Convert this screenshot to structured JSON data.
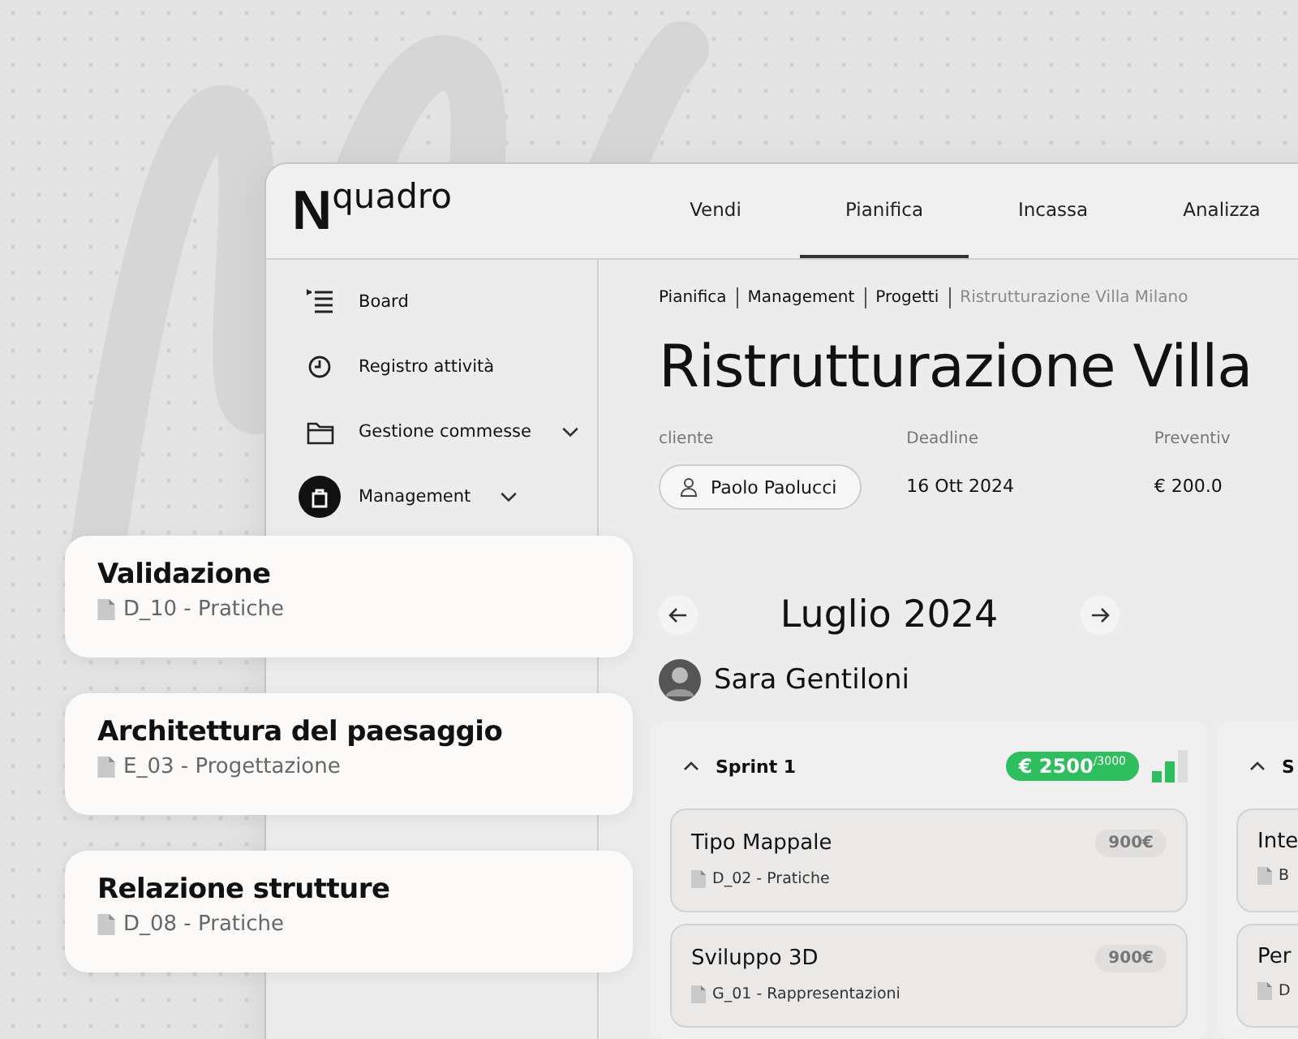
{
  "brand": {
    "logo_letter": "N",
    "name": "quadro"
  },
  "nav_tabs": [
    {
      "label": "Vendi",
      "selected": false
    },
    {
      "label": "Pianifica",
      "selected": true
    },
    {
      "label": "Incassa",
      "selected": false
    },
    {
      "label": "Analizza",
      "selected": false
    }
  ],
  "sidebar": {
    "items": [
      {
        "label": "Board",
        "kind": "board",
        "selected": false,
        "has_submenu": false
      },
      {
        "label": "Registro attività",
        "kind": "clock",
        "selected": false,
        "has_submenu": false
      },
      {
        "label": "Gestione commesse",
        "kind": "folder",
        "selected": false,
        "has_submenu": true
      },
      {
        "label": "Management",
        "kind": "bag",
        "selected": true,
        "has_submenu": true
      }
    ]
  },
  "breadcrumb": [
    {
      "label": "Pianifica",
      "current": false
    },
    {
      "label": "Management",
      "current": false
    },
    {
      "label": "Progetti",
      "current": false
    },
    {
      "label": "Ristrutturazione Villa Milano",
      "current": true
    }
  ],
  "title": "Ristrutturazione Villa",
  "fields": [
    {
      "label": "cliente",
      "value": "Paolo Paolucci",
      "kind": "person"
    },
    {
      "label": "Deadline",
      "value": "16 Ott 2024",
      "kind": "text"
    },
    {
      "label": "Preventiv",
      "value": "€ 200.0",
      "kind": "text"
    }
  ],
  "month": "Luglio 2024",
  "person": "Sara Gentiloni",
  "sprints": [
    {
      "name": "Sprint 1",
      "budget": "€ 2500$^{/3000}$",
      "tasks": [
        {
          "title": "Tipo Mappale",
          "code": "D_02 - Pratiche",
          "price": "900€"
        },
        {
          "title": "Sviluppo 3D",
          "code": "G_01 - Rappresentazioni",
          "price": "900€"
        }
      ]
    },
    {
      "name": "S",
      "tasks": [
        {
          "title": "Inte",
          "code": "B"
        },
        {
          "title": "Per",
          "code": "D"
        }
      ]
    }
  ],
  "floating_cards": [
    {
      "title": "Validazione",
      "code": "D_10 - Pratiche"
    },
    {
      "title": "Architettura del paesaggio",
      "code": "E_03 - Progettazione"
    },
    {
      "title": "Relazione strutture",
      "code": "D_08 - Pratiche"
    }
  ]
}
